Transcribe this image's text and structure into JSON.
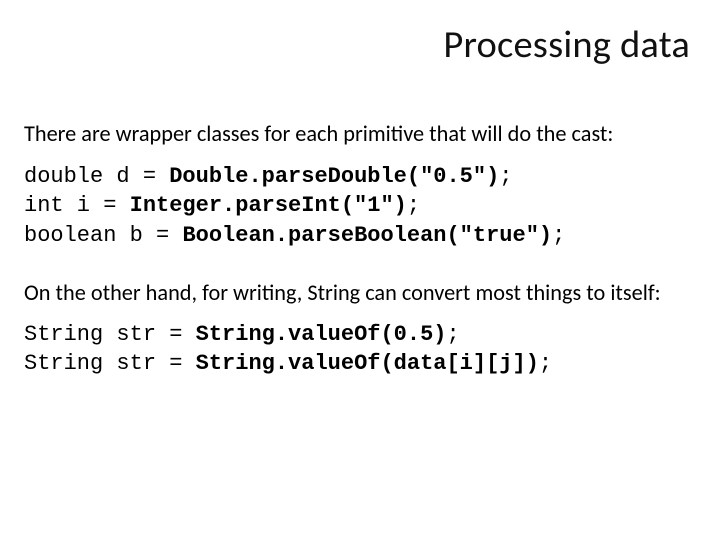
{
  "title": "Processing data",
  "para1": "There are wrapper classes for each primitive that will do the cast:",
  "code1": {
    "l1a": "double d = ",
    "l1b": "Double.parseDouble(\"0.5\")",
    "l1c": ";",
    "l2a": "int i = ",
    "l2b": "Integer.parseInt(\"1\")",
    "l2c": ";",
    "l3a": "boolean b = ",
    "l3b": "Boolean.parseBoolean(\"true\")",
    "l3c": ";"
  },
  "para2": "On the other hand, for writing, String can convert most things to itself:",
  "code2": {
    "l1a": "String str = ",
    "l1b": "String.valueOf(0.5)",
    "l1c": ";",
    "l2a": "String str = ",
    "l2b": "String.valueOf(data[i][j])",
    "l2c": ";"
  }
}
